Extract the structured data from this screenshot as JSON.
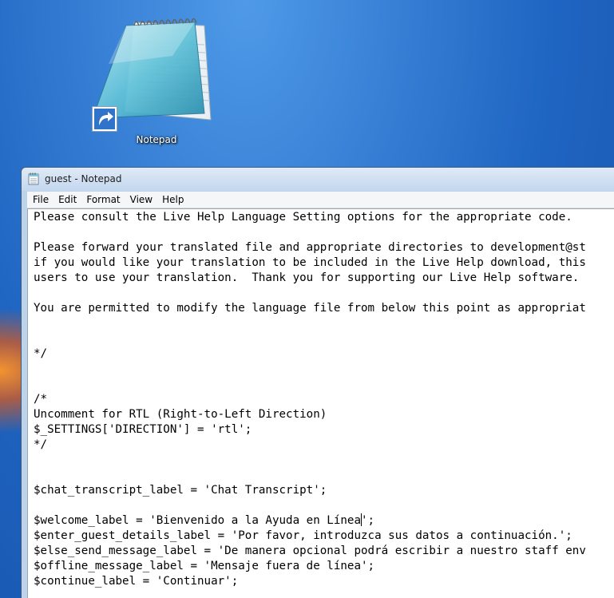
{
  "desktop": {
    "icon_label": "Notepad"
  },
  "window": {
    "title": "guest - Notepad",
    "menu": [
      "File",
      "Edit",
      "Format",
      "View",
      "Help"
    ]
  },
  "editor": {
    "lines": [
      "Please consult the Live Help Language Setting options for the appropriate code.",
      "",
      "Please forward your translated file and appropriate directories to development@st",
      "if you would like your translation to be included in the Live Help download, this",
      "users to use your translation.  Thank you for supporting our Live Help software.",
      "",
      "You are permitted to modify the language file from below this point as appropriat",
      "",
      "",
      "*/",
      "",
      "",
      "/*",
      "Uncomment for RTL (Right-to-Left Direction)",
      "$_SETTINGS['DIRECTION'] = 'rtl';",
      "*/",
      "",
      "",
      "$chat_transcript_label = 'Chat Transcript';",
      "",
      "$welcome_label = 'Bienvenido a la Ayuda en Línea';",
      "$enter_guest_details_label = 'Por favor, introduzca sus datos a continuación.';",
      "$else_send_message_label = 'De manera opcional podrá escribir a nuestro staff env",
      "$offline_message_label = 'Mensaje fuera de línea';",
      "$continue_label = 'Continuar';"
    ],
    "caret": {
      "line": 20,
      "column": 48
    }
  },
  "icons": {
    "desktop": "notepad-icon",
    "shortcut": "shortcut-arrow-icon",
    "title": "notepad-small-icon"
  }
}
